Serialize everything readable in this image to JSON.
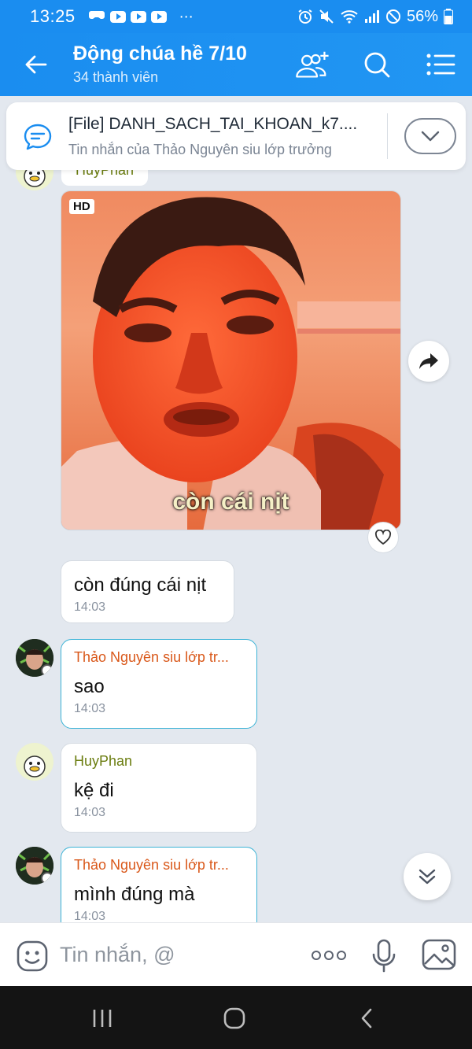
{
  "status_bar": {
    "time": "13:25",
    "battery": "56%",
    "more": "⋯"
  },
  "header": {
    "title": "Động chúa hề 7/10",
    "subtitle": "34 thành viên"
  },
  "pinned": {
    "title": "[File] DANH_SACH_TAI_KHOAN_k7....",
    "subtitle": "Tin nhắn của Thảo Nguyên siu lớp trưởng"
  },
  "chat": {
    "top_sender": "HuyPhan",
    "photo": {
      "badge": "HD",
      "caption": "còn cái nịt"
    },
    "messages": [
      {
        "sender": "",
        "text": "còn đúng cái nịt",
        "time": "14:03"
      },
      {
        "sender": "Thảo Nguyên siu lớp tr...",
        "text": "sao",
        "time": "14:03"
      },
      {
        "sender": "HuyPhan",
        "text": "kệ đi",
        "time": "14:03"
      },
      {
        "sender": "Thảo Nguyên siu lớp tr...",
        "text": "mình đúng mà",
        "time": "14:03"
      }
    ]
  },
  "composer": {
    "placeholder": "Tin nhắn, @"
  },
  "colors": {
    "brand": "#1a8df0",
    "sender_orange": "#d9581a",
    "sender_olive": "#6b7d10",
    "bubble_border_accent": "#3bb3d6"
  },
  "icons": {
    "back": "arrow-left-icon",
    "add_member": "add-user-icon",
    "search": "search-icon",
    "menu": "list-menu-icon",
    "pinned": "chat-bubble-icon",
    "expand": "chevron-down-icon",
    "share": "share-arrow-icon",
    "like": "heart-icon",
    "scroll_down": "double-chevron-down-icon",
    "emoji": "emoji-icon",
    "more": "more-dots-icon",
    "mic": "microphone-icon",
    "image": "image-icon"
  }
}
